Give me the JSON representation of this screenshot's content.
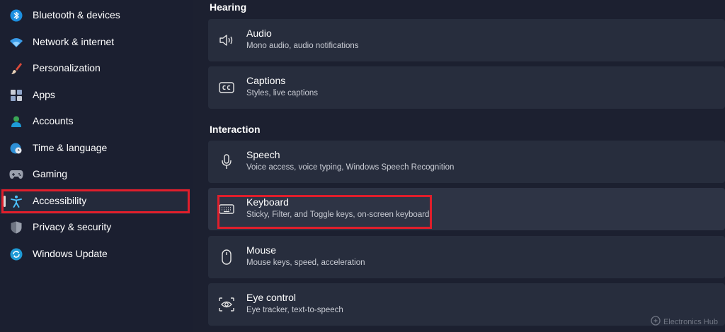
{
  "sidebar": {
    "items": [
      {
        "label": "Bluetooth & devices",
        "icon": "bluetooth-icon"
      },
      {
        "label": "Network & internet",
        "icon": "wifi-icon"
      },
      {
        "label": "Personalization",
        "icon": "brush-icon"
      },
      {
        "label": "Apps",
        "icon": "apps-icon"
      },
      {
        "label": "Accounts",
        "icon": "person-icon"
      },
      {
        "label": "Time & language",
        "icon": "globe-clock-icon"
      },
      {
        "label": "Gaming",
        "icon": "gamepad-icon"
      },
      {
        "label": "Accessibility",
        "icon": "accessibility-icon"
      },
      {
        "label": "Privacy & security",
        "icon": "shield-icon"
      },
      {
        "label": "Windows Update",
        "icon": "sync-icon"
      }
    ],
    "selected_label": "Accessibility"
  },
  "main": {
    "sections": [
      {
        "title": "Hearing",
        "cards": [
          {
            "title": "Audio",
            "subtitle": "Mono audio, audio notifications",
            "icon": "speaker-icon"
          },
          {
            "title": "Captions",
            "subtitle": "Styles, live captions",
            "icon": "cc-icon"
          }
        ]
      },
      {
        "title": "Interaction",
        "cards": [
          {
            "title": "Speech",
            "subtitle": "Voice access, voice typing, Windows Speech Recognition",
            "icon": "microphone-icon"
          },
          {
            "title": "Keyboard",
            "subtitle": "Sticky, Filter, and Toggle keys, on-screen keyboard",
            "icon": "keyboard-icon"
          },
          {
            "title": "Mouse",
            "subtitle": "Mouse keys, speed, acceleration",
            "icon": "mouse-icon"
          },
          {
            "title": "Eye control",
            "subtitle": "Eye tracker, text-to-speech",
            "icon": "eye-control-icon"
          }
        ]
      }
    ]
  },
  "highlight_color": "#e01e2b",
  "accent_color": "#4cc2ff",
  "watermark": {
    "text": "Electronics Hub"
  }
}
